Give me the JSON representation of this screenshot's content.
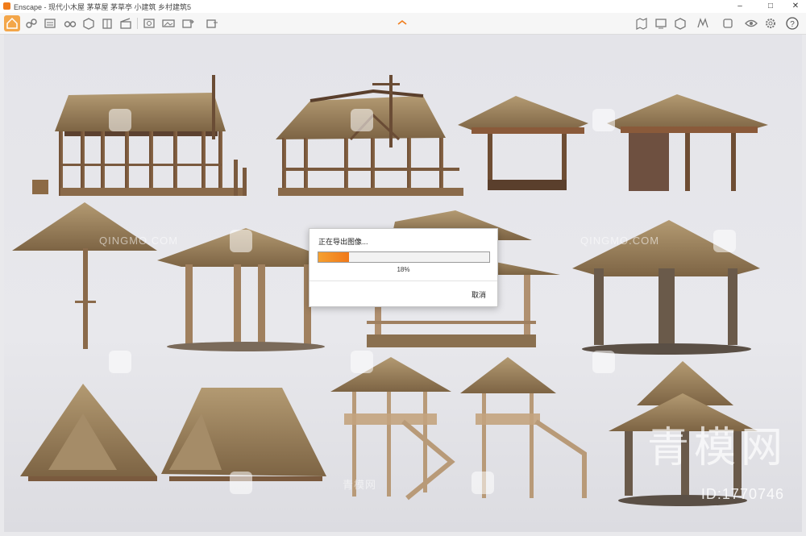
{
  "window": {
    "title": "Enscape - 现代小木屋 茅草屋 茅草亭 小建筑 乡村建筑5",
    "controls": [
      "minimize-icon",
      "maximize-icon",
      "close-icon"
    ]
  },
  "toolbar": {
    "left_tools": [
      "home-icon",
      "link-icon",
      "bim-icon",
      "binoculars-icon",
      "cube-icon",
      "building-icon",
      "clapper-icon",
      "screenshot-icon",
      "panorama-icon",
      "export-icon",
      "export-batch-icon"
    ],
    "right_tools": [
      "map-icon",
      "monitor-icon",
      "asset-icon",
      "material-icon",
      "sync-icon",
      "eye-icon",
      "settings-icon",
      "help-icon"
    ],
    "collapse_icon": "chevron-up-icon",
    "accent": "#f3a64a"
  },
  "viewport": {
    "watermarks": [
      "QINGMO.COM",
      "QINGMO.COM",
      "青模网"
    ],
    "brand_watermark": "青模网",
    "id_label": "ID:1770746"
  },
  "dialog": {
    "title": "正在导出图像...",
    "progress": 0.18,
    "progress_text": "18%",
    "cancel_label": "取消",
    "accent": "#f0781a"
  }
}
